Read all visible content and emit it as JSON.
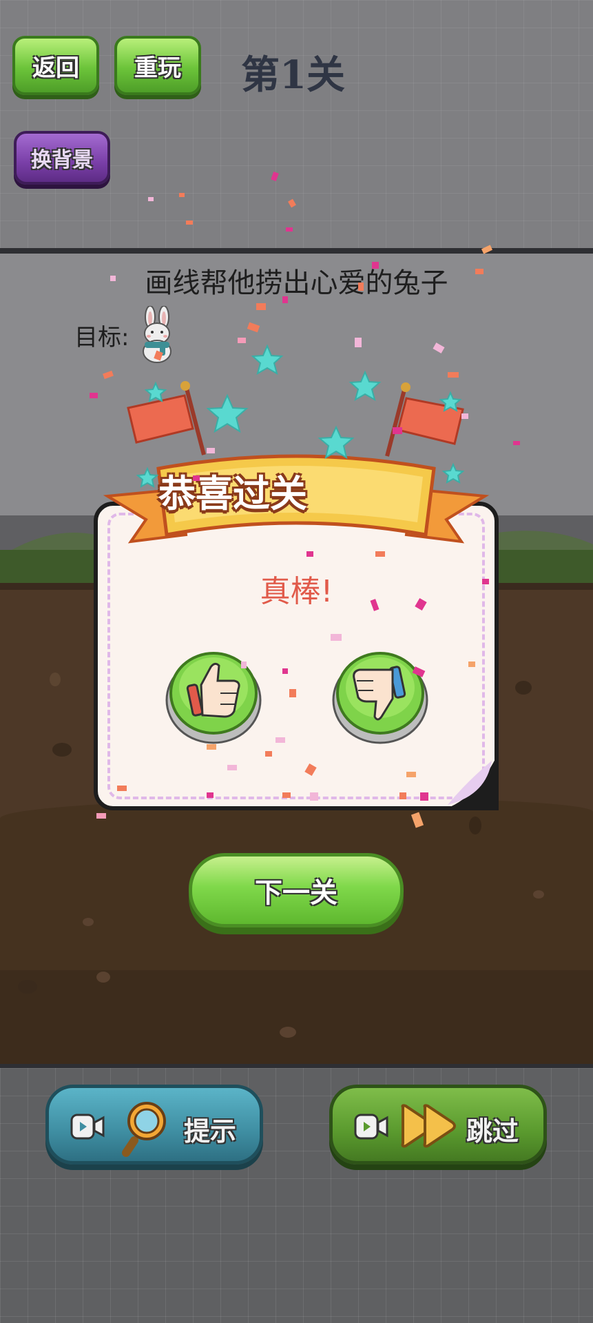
{
  "header": {
    "back_label": "返回",
    "replay_label": "重玩",
    "change_bg_label": "换背景",
    "level_title": "第1关"
  },
  "scene": {
    "instruction": "画线帮他捞出心爱的兔子",
    "goal_label": "目标:"
  },
  "popup": {
    "banner_title": "恭喜过关",
    "praise": "真棒!",
    "like_icon": "thumbs-up-icon",
    "dislike_icon": "thumbs-down-icon",
    "next_label": "下一关"
  },
  "footer": {
    "hint_label": "提示",
    "skip_label": "跳过"
  },
  "colors": {
    "green_button": "#6cc43a",
    "purple_button": "#7a3fa8",
    "hint_button": "#3f8ea2",
    "skip_button": "#5a9a2e",
    "banner_yellow": "#f5c94a",
    "praise_red": "#e15a4a"
  }
}
